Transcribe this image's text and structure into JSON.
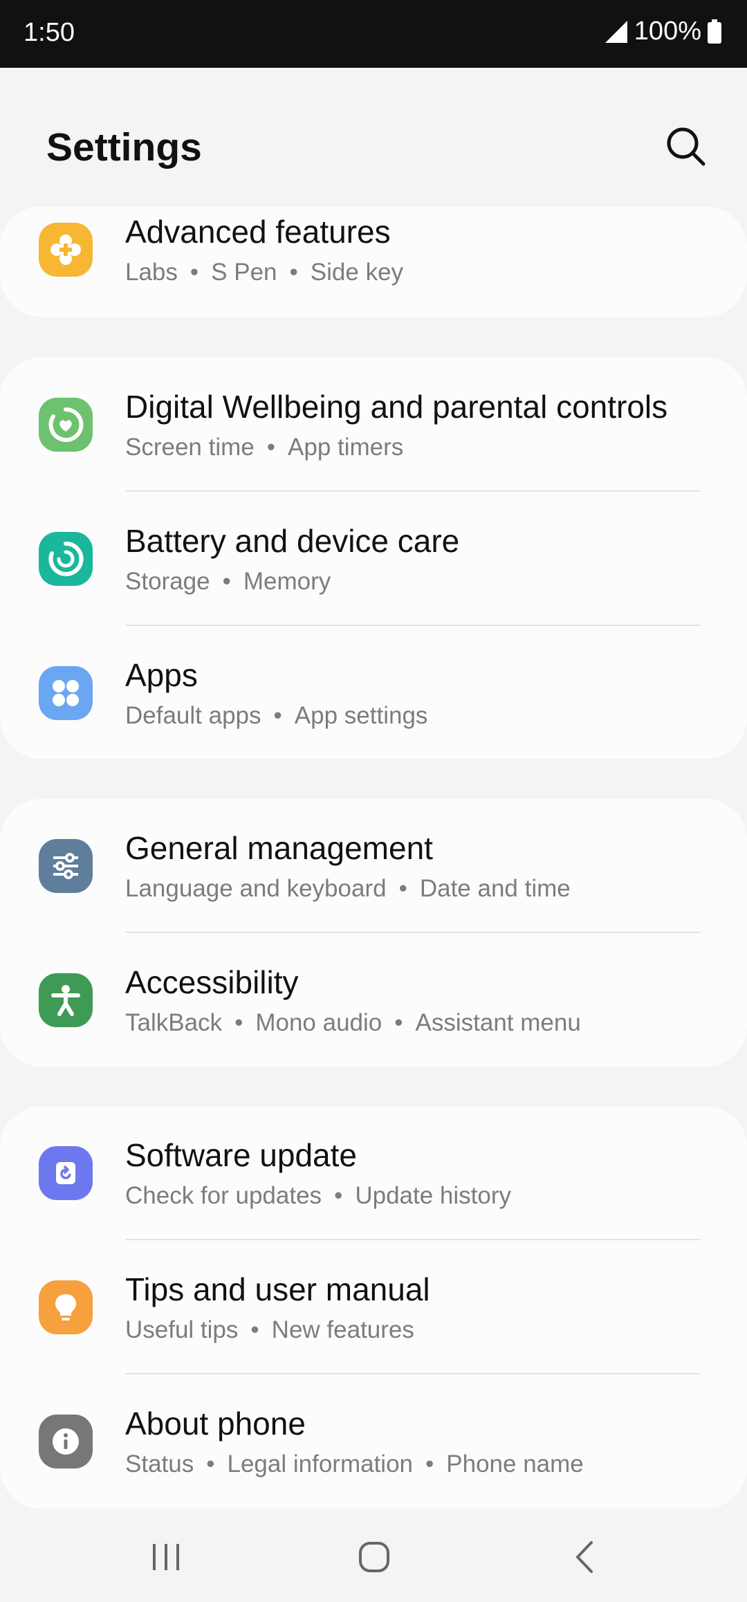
{
  "status": {
    "time": "1:50",
    "battery": "100%"
  },
  "header": {
    "title": "Settings"
  },
  "groups": [
    {
      "items": [
        {
          "title": "Advanced features",
          "subs": [
            "Labs",
            "S Pen",
            "Side key"
          ],
          "icon": "advanced-features-icon",
          "color": "#f7b733"
        }
      ]
    },
    {
      "items": [
        {
          "title": "Digital Wellbeing and parental controls",
          "subs": [
            "Screen time",
            "App timers"
          ],
          "icon": "digital-wellbeing-icon",
          "color": "#6cc26e"
        },
        {
          "title": "Battery and device care",
          "subs": [
            "Storage",
            "Memory"
          ],
          "icon": "device-care-icon",
          "color": "#1bb79c"
        },
        {
          "title": "Apps",
          "subs": [
            "Default apps",
            "App settings"
          ],
          "icon": "apps-icon",
          "color": "#6aa6f2"
        }
      ]
    },
    {
      "items": [
        {
          "title": "General management",
          "subs": [
            "Language and keyboard",
            "Date and time"
          ],
          "icon": "general-management-icon",
          "color": "#5f7e9c"
        },
        {
          "title": "Accessibility",
          "subs": [
            "TalkBack",
            "Mono audio",
            "Assistant menu"
          ],
          "icon": "accessibility-icon",
          "color": "#3e9a55"
        }
      ]
    },
    {
      "items": [
        {
          "title": "Software update",
          "subs": [
            "Check for updates",
            "Update history"
          ],
          "icon": "software-update-icon",
          "color": "#6e78ee"
        },
        {
          "title": "Tips and user manual",
          "subs": [
            "Useful tips",
            "New features"
          ],
          "icon": "tips-icon",
          "color": "#f6a03e"
        },
        {
          "title": "About phone",
          "subs": [
            "Status",
            "Legal information",
            "Phone name"
          ],
          "icon": "info-icon",
          "color": "#777777"
        }
      ]
    }
  ],
  "nav": {
    "icons": [
      "recent-apps-icon",
      "home-icon",
      "back-icon"
    ]
  }
}
